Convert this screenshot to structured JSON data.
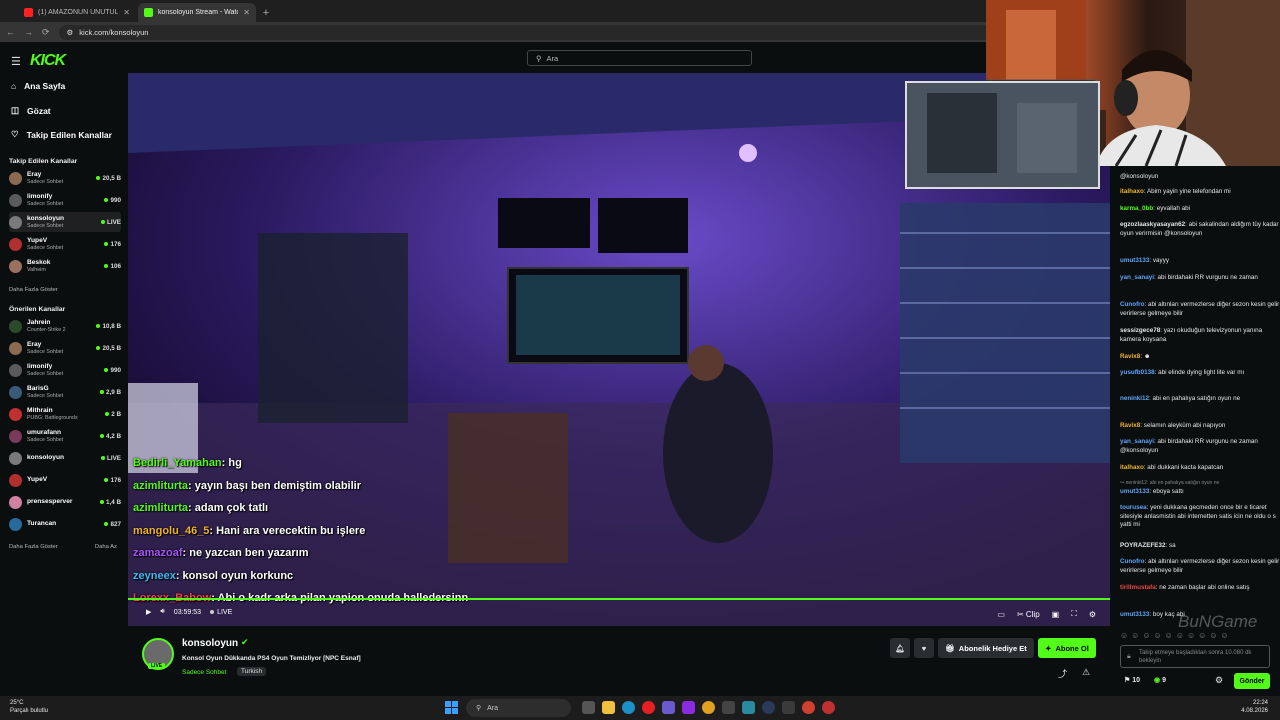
{
  "browser": {
    "tabs": [
      {
        "label": "(1) AMAZONUN UNUTULAN K...",
        "color": "#ff2020"
      },
      {
        "label": "konsoloyun Stream - Watch Liv...",
        "color": "#53fc18"
      }
    ],
    "url": "kick.com/konsoloyun"
  },
  "sidebar": {
    "logo": "KICK",
    "nav": [
      "Ana Sayfa",
      "Gözat",
      "Takip Edilen Kanallar"
    ],
    "followed_title": "Takip Edilen Kanallar",
    "followed": [
      {
        "name": "Eray",
        "sub": "Sadece Sohbet",
        "viewers": "20,5 B"
      },
      {
        "name": "limonify",
        "sub": "Sadece Sohbet",
        "viewers": "990"
      },
      {
        "name": "konsoloyun",
        "sub": "Sadece Sohbet",
        "viewers": "LIVE"
      },
      {
        "name": "YupeV",
        "sub": "Sadece Sohbet",
        "viewers": "176"
      },
      {
        "name": "Beskok",
        "sub": "Valheim",
        "viewers": "106"
      }
    ],
    "show_more": "Daha Fazla Göster",
    "recommended_title": "Önerilen Kanallar",
    "recommended": [
      {
        "name": "Jahrein",
        "sub": "Counter-Strike 2",
        "viewers": "10,8 B"
      },
      {
        "name": "Eray",
        "sub": "Sadece Sohbet",
        "viewers": "20,5 B"
      },
      {
        "name": "limonify",
        "sub": "Sadece Sohbet",
        "viewers": "990"
      },
      {
        "name": "BarisG",
        "sub": "Sadece Sohbet",
        "viewers": "2,9 B"
      },
      {
        "name": "Mithrain",
        "sub": "PUBG: Battlegrounds",
        "viewers": "2 B"
      },
      {
        "name": "umurafann",
        "sub": "Sadece Sohbet",
        "viewers": "4,2 B"
      },
      {
        "name": "konsoloyun",
        "sub": "",
        "viewers": "LIVE"
      },
      {
        "name": "YupeV",
        "sub": "",
        "viewers": "176"
      },
      {
        "name": "prensesperver",
        "sub": "",
        "viewers": "1,4 B"
      },
      {
        "name": "Turancan",
        "sub": "",
        "viewers": "827"
      }
    ],
    "show_more2": "Daha Fazla Göster",
    "show_less": "Daha Az"
  },
  "search": {
    "placeholder": "Ara"
  },
  "video_overlay_chat": [
    {
      "user": "Bedirli_Yamahan",
      "text": ": hg",
      "color": "#53fc18"
    },
    {
      "user": "azimliturta",
      "text": ": yayın başı ben demiştim olabilir",
      "color": "#53fc18"
    },
    {
      "user": "azimliturta",
      "text": ": adam çok tatlı",
      "color": "#53fc18"
    },
    {
      "user": "mangolu_46_5",
      "text": ": Hani ara verecektin bu işlere",
      "color": "#f0b429"
    },
    {
      "user": "zamazoaf",
      "text": ": ne yazcan ben yazarım",
      "color": "#a855f7"
    },
    {
      "user": "zeyneex",
      "text": ": konsol oyun korkunc",
      "color": "#38bdf8"
    },
    {
      "user": "Lorexx_Babow",
      "text": ": Abi o kadr arka pilan yapion onuda halledersinn",
      "color": "#ef4444"
    }
  ],
  "player": {
    "time": "03:59:53",
    "live": "LIVE",
    "clip": "Clip"
  },
  "stream": {
    "channel": "konsoloyun",
    "title": "Konsol Oyun Dükkanda PS4 Oyun Temizliyor [NPC Esnaf]",
    "category": "Sadece Sohbet",
    "tag": "Turkish",
    "live_badge": "LIVE",
    "gift_label": "Abonelik Hediye Et",
    "subscribe_label": "Abone Ol"
  },
  "chat": {
    "messages": [
      {
        "user": "",
        "text": "@konsoloyun",
        "color": "#ffffff"
      },
      {
        "user": "italhaxo",
        "text": ": Abim yayin yine telefondan mi",
        "color": "#f0b429"
      },
      {
        "user": "karma_0bb",
        "text": ": eyvallah abi",
        "color": "#53fc18"
      },
      {
        "user": "egzozlaaskyasayan62",
        "text": ": abi sakalindan aldiğım tüy kadar oyun verirmisin @konsoloyun",
        "color": "#e5e5e5"
      },
      {
        "user": "umut3133",
        "text": ": vayyy",
        "color": "#60a5fa"
      },
      {
        "user": "yan_sanayi",
        "text": ": abi birdahaki RR vurgunu ne zaman",
        "color": "#60a5fa"
      },
      {
        "user": "Cunofro",
        "text": ": abi altınları vermezlerse diğer sezon kesin gelir verirlerse gelmeye bilir",
        "color": "#60a5fa"
      },
      {
        "user": "sessizgece78",
        "text": ": yazı okuduğun televizyonun yanına kamera koysana",
        "color": "#e5e5e5"
      },
      {
        "user": "Ravix8",
        "text": ":",
        "color": "#f0b429"
      },
      {
        "user": "yusufb0138",
        "text": ": abi elinde dying light lite var mı",
        "color": "#60a5fa"
      },
      {
        "user": "neninki12",
        "text": ": abi en pahalıya satığın oyun ne",
        "color": "#60a5fa"
      },
      {
        "user": "Ravix8",
        "text": ": selamın aleyküm abi napıyon",
        "color": "#f0b429"
      },
      {
        "user": "yan_sanayi",
        "text": ": abi birdahaki RR vurgunu ne zaman @konsoloyun",
        "color": "#60a5fa"
      },
      {
        "user": "italhaxo",
        "text": ": abi dukkani kacta kapatcan",
        "color": "#f0b429"
      },
      {
        "user": "umut3133",
        "text": ": eboya sattı",
        "color": "#60a5fa"
      },
      {
        "user": "tourusea",
        "text": ": yeni dukkana gecmeden once bir e ticaret sitesiyle anlasmistin abi internetten satis icin ne oldu o s yatti mi",
        "color": "#60a5fa"
      },
      {
        "user": "POYRAZEFE32",
        "text": ": sa",
        "color": "#e5e5e5"
      },
      {
        "user": "Cunofro",
        "text": ": abi altınları vermezlerse diğer sezon kesin gelir verirlerse gelmeye bilir",
        "color": "#60a5fa"
      },
      {
        "user": "tirillmustafa",
        "text": ": ne zaman başlar abi online satış",
        "color": "#ef4444"
      },
      {
        "user": "umut3133",
        "text": ": boy kaç abi",
        "color": "#60a5fa"
      }
    ],
    "reply_hint": "↪ neninki12: abi en pahalıya satığın oyun ne",
    "input_placeholder": "Takip etmeye başladıktan sonra 10.080 dk bekleyin",
    "points_a": "10",
    "points_b": "9",
    "send_label": "Gönder",
    "watermark": "BuNGame"
  },
  "taskbar": {
    "weather_temp": "25°C",
    "weather_desc": "Parçalı bulutlu",
    "search_placeholder": "Ara",
    "time": "22:24",
    "date": "4.08.2026"
  }
}
